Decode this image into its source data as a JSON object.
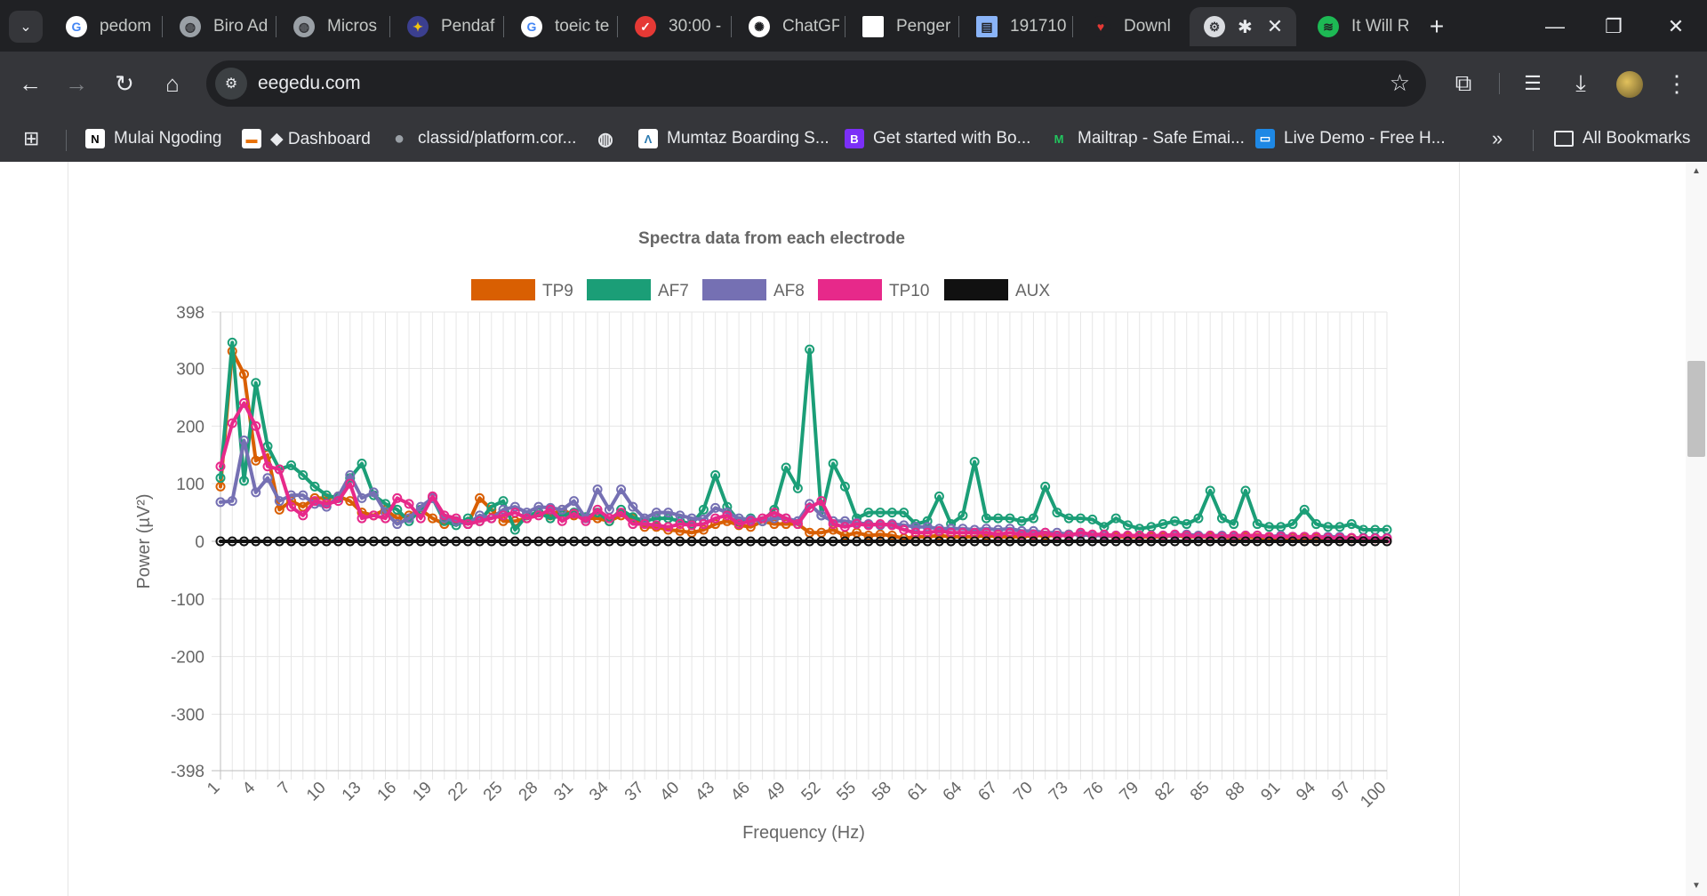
{
  "browser": {
    "tabs": [
      {
        "title": "pedom",
        "icon": "google-icon"
      },
      {
        "title": "Biro Ad",
        "icon": "globe-icon"
      },
      {
        "title": "Micros",
        "icon": "globe-icon"
      },
      {
        "title": "Pendaf",
        "icon": "university-icon"
      },
      {
        "title": "toeic te",
        "icon": "google-icon"
      },
      {
        "title": "30:00 -",
        "icon": "timer-check-icon"
      },
      {
        "title": "ChatGP",
        "icon": "chatgpt-icon"
      },
      {
        "title": "Penger",
        "icon": "document-icon"
      },
      {
        "title": "191710",
        "icon": "file-icon"
      },
      {
        "title": "Downl",
        "icon": "heart-icon"
      },
      {
        "title": "",
        "icon": "bluetooth-icon",
        "active": true
      },
      {
        "title": "It Will R",
        "icon": "spotify-icon"
      }
    ],
    "url": "eegedu.com",
    "bookmarks": [
      {
        "label": "Mulai Ngoding",
        "icon": "notion-icon"
      },
      {
        "label": "◆ Dashboard",
        "icon": "dashboard-icon"
      },
      {
        "label": "classid/platform.cor...",
        "icon": "github-icon"
      },
      {
        "label": "",
        "icon": "globe-icon"
      },
      {
        "label": "Mumtaz Boarding S...",
        "icon": "mumtaz-icon"
      },
      {
        "label": "Get started with Bo...",
        "icon": "bootstrap-icon"
      },
      {
        "label": "Mailtrap - Safe Emai...",
        "icon": "mailtrap-icon"
      },
      {
        "label": "Live Demo - Free H...",
        "icon": "live-demo-icon"
      }
    ],
    "overflow_label": "»",
    "all_bookmarks_label": "All Bookmarks"
  },
  "chart_data": {
    "type": "line",
    "title": "Spectra data from each electrode",
    "xlabel": "Frequency (Hz)",
    "ylabel": "Power (µV²)",
    "ylim": [
      -398,
      398
    ],
    "yticks": [
      398,
      300,
      200,
      100,
      0,
      -100,
      -200,
      -300,
      -398
    ],
    "xticks": [
      1,
      4,
      7,
      10,
      13,
      16,
      19,
      22,
      25,
      28,
      31,
      34,
      37,
      40,
      43,
      46,
      49,
      52,
      55,
      58,
      61,
      64,
      67,
      70,
      73,
      76,
      79,
      82,
      85,
      88,
      91,
      94,
      97,
      100
    ],
    "grid": true,
    "legend_position": "top-center",
    "x": [
      1,
      2,
      3,
      4,
      5,
      6,
      7,
      8,
      9,
      10,
      11,
      12,
      13,
      14,
      15,
      16,
      17,
      18,
      19,
      20,
      21,
      22,
      23,
      24,
      25,
      26,
      27,
      28,
      29,
      30,
      31,
      32,
      33,
      34,
      35,
      36,
      37,
      38,
      39,
      40,
      41,
      42,
      43,
      44,
      45,
      46,
      47,
      48,
      49,
      50,
      51,
      52,
      53,
      54,
      55,
      56,
      57,
      58,
      59,
      60,
      61,
      62,
      63,
      64,
      65,
      66,
      67,
      68,
      69,
      70,
      71,
      72,
      73,
      74,
      75,
      76,
      77,
      78,
      79,
      80,
      81,
      82,
      83,
      84,
      85,
      86,
      87,
      88,
      89,
      90,
      91,
      92,
      93,
      94,
      95,
      96,
      97,
      98,
      99,
      100
    ],
    "series": [
      {
        "name": "TP9",
        "color": "#d95f02",
        "values": [
          95,
          330,
          290,
          140,
          150,
          55,
          70,
          60,
          75,
          75,
          78,
          70,
          50,
          45,
          55,
          40,
          45,
          55,
          40,
          30,
          35,
          30,
          75,
          55,
          35,
          35,
          40,
          50,
          45,
          55,
          45,
          40,
          40,
          35,
          45,
          40,
          25,
          25,
          20,
          18,
          15,
          20,
          30,
          35,
          28,
          25,
          35,
          30,
          30,
          30,
          15,
          15,
          20,
          10,
          15,
          10,
          12,
          10,
          5,
          8,
          8,
          10,
          8,
          8,
          8,
          10,
          8,
          8,
          8,
          10,
          10,
          10,
          12,
          12,
          10,
          10,
          8,
          8,
          8,
          8,
          8,
          10,
          8,
          8,
          8,
          8,
          5,
          8,
          6,
          6,
          5,
          6,
          5,
          5,
          6,
          5,
          5,
          6,
          5,
          5
        ]
      },
      {
        "name": "AF7",
        "color": "#1b9e77",
        "values": [
          110,
          345,
          105,
          275,
          165,
          125,
          132,
          115,
          95,
          80,
          75,
          110,
          135,
          80,
          65,
          55,
          35,
          55,
          75,
          35,
          28,
          40,
          35,
          60,
          70,
          20,
          45,
          50,
          40,
          45,
          50,
          42,
          50,
          35,
          55,
          42,
          35,
          40,
          40,
          35,
          30,
          55,
          115,
          60,
          35,
          40,
          35,
          55,
          128,
          92,
          333,
          45,
          135,
          95,
          40,
          50,
          50,
          50,
          50,
          30,
          35,
          78,
          30,
          45,
          138,
          40,
          40,
          40,
          35,
          40,
          95,
          50,
          40,
          40,
          38,
          25,
          40,
          28,
          22,
          25,
          30,
          35,
          30,
          40,
          88,
          40,
          30,
          88,
          30,
          25,
          25,
          30,
          55,
          30,
          25,
          25,
          30,
          20,
          20,
          20
        ]
      },
      {
        "name": "AF8",
        "color": "#7570b3",
        "values": [
          68,
          70,
          175,
          85,
          110,
          70,
          80,
          80,
          65,
          60,
          78,
          115,
          75,
          85,
          50,
          30,
          40,
          60,
          75,
          40,
          35,
          30,
          45,
          40,
          55,
          60,
          50,
          60,
          58,
          55,
          70,
          40,
          90,
          55,
          90,
          60,
          40,
          50,
          50,
          45,
          40,
          38,
          58,
          50,
          40,
          38,
          35,
          40,
          40,
          35,
          65,
          45,
          35,
          35,
          32,
          30,
          28,
          30,
          28,
          25,
          25,
          22,
          22,
          22,
          20,
          22,
          20,
          22,
          18,
          18,
          15,
          15,
          12,
          12,
          10,
          10,
          10,
          10,
          10,
          10,
          10,
          10,
          12,
          10,
          10,
          10,
          8,
          10,
          10,
          8,
          10,
          8,
          8,
          8,
          8,
          8,
          6,
          6,
          6,
          6
        ]
      },
      {
        "name": "TP10",
        "color": "#e7298a",
        "values": [
          130,
          205,
          240,
          200,
          130,
          125,
          60,
          45,
          70,
          65,
          70,
          100,
          40,
          45,
          40,
          75,
          65,
          40,
          78,
          45,
          40,
          30,
          35,
          40,
          45,
          50,
          40,
          45,
          55,
          35,
          48,
          35,
          55,
          40,
          50,
          30,
          30,
          28,
          25,
          30,
          28,
          30,
          40,
          45,
          30,
          35,
          40,
          50,
          40,
          30,
          58,
          70,
          30,
          25,
          30,
          28,
          30,
          28,
          20,
          15,
          15,
          18,
          15,
          15,
          15,
          15,
          12,
          15,
          12,
          12,
          15,
          10,
          10,
          15,
          12,
          12,
          10,
          10,
          10,
          10,
          10,
          12,
          10,
          8,
          10,
          8,
          10,
          10,
          10,
          8,
          8,
          8,
          8,
          8,
          6,
          6,
          6,
          5,
          5,
          5
        ]
      },
      {
        "name": "AUX",
        "color": "#111111",
        "values": [
          0,
          0,
          0,
          0,
          0,
          0,
          0,
          0,
          0,
          0,
          0,
          0,
          0,
          0,
          0,
          0,
          0,
          0,
          0,
          0,
          0,
          0,
          0,
          0,
          0,
          0,
          0,
          0,
          0,
          0,
          0,
          0,
          0,
          0,
          0,
          0,
          0,
          0,
          0,
          0,
          0,
          0,
          0,
          0,
          0,
          0,
          0,
          0,
          0,
          0,
          0,
          0,
          0,
          0,
          0,
          0,
          0,
          0,
          0,
          0,
          0,
          0,
          0,
          0,
          0,
          0,
          0,
          0,
          0,
          0,
          0,
          0,
          0,
          0,
          0,
          0,
          0,
          0,
          0,
          0,
          0,
          0,
          0,
          0,
          0,
          0,
          0,
          0,
          0,
          0,
          0,
          0,
          0,
          0,
          0,
          0,
          0,
          0,
          0,
          0
        ]
      }
    ]
  }
}
